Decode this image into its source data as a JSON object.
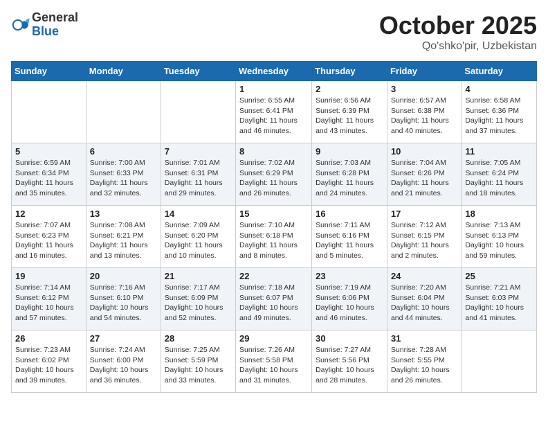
{
  "logo": {
    "general": "General",
    "blue": "Blue"
  },
  "header": {
    "month": "October 2025",
    "location": "Qo'shko'pir, Uzbekistan"
  },
  "weekdays": [
    "Sunday",
    "Monday",
    "Tuesday",
    "Wednesday",
    "Thursday",
    "Friday",
    "Saturday"
  ],
  "weeks": [
    [
      {
        "day": "",
        "info": ""
      },
      {
        "day": "",
        "info": ""
      },
      {
        "day": "",
        "info": ""
      },
      {
        "day": "1",
        "info": "Sunrise: 6:55 AM\nSunset: 6:41 PM\nDaylight: 11 hours and 46 minutes."
      },
      {
        "day": "2",
        "info": "Sunrise: 6:56 AM\nSunset: 6:39 PM\nDaylight: 11 hours and 43 minutes."
      },
      {
        "day": "3",
        "info": "Sunrise: 6:57 AM\nSunset: 6:38 PM\nDaylight: 11 hours and 40 minutes."
      },
      {
        "day": "4",
        "info": "Sunrise: 6:58 AM\nSunset: 6:36 PM\nDaylight: 11 hours and 37 minutes."
      }
    ],
    [
      {
        "day": "5",
        "info": "Sunrise: 6:59 AM\nSunset: 6:34 PM\nDaylight: 11 hours and 35 minutes."
      },
      {
        "day": "6",
        "info": "Sunrise: 7:00 AM\nSunset: 6:33 PM\nDaylight: 11 hours and 32 minutes."
      },
      {
        "day": "7",
        "info": "Sunrise: 7:01 AM\nSunset: 6:31 PM\nDaylight: 11 hours and 29 minutes."
      },
      {
        "day": "8",
        "info": "Sunrise: 7:02 AM\nSunset: 6:29 PM\nDaylight: 11 hours and 26 minutes."
      },
      {
        "day": "9",
        "info": "Sunrise: 7:03 AM\nSunset: 6:28 PM\nDaylight: 11 hours and 24 minutes."
      },
      {
        "day": "10",
        "info": "Sunrise: 7:04 AM\nSunset: 6:26 PM\nDaylight: 11 hours and 21 minutes."
      },
      {
        "day": "11",
        "info": "Sunrise: 7:05 AM\nSunset: 6:24 PM\nDaylight: 11 hours and 18 minutes."
      }
    ],
    [
      {
        "day": "12",
        "info": "Sunrise: 7:07 AM\nSunset: 6:23 PM\nDaylight: 11 hours and 16 minutes."
      },
      {
        "day": "13",
        "info": "Sunrise: 7:08 AM\nSunset: 6:21 PM\nDaylight: 11 hours and 13 minutes."
      },
      {
        "day": "14",
        "info": "Sunrise: 7:09 AM\nSunset: 6:20 PM\nDaylight: 11 hours and 10 minutes."
      },
      {
        "day": "15",
        "info": "Sunrise: 7:10 AM\nSunset: 6:18 PM\nDaylight: 11 hours and 8 minutes."
      },
      {
        "day": "16",
        "info": "Sunrise: 7:11 AM\nSunset: 6:16 PM\nDaylight: 11 hours and 5 minutes."
      },
      {
        "day": "17",
        "info": "Sunrise: 7:12 AM\nSunset: 6:15 PM\nDaylight: 11 hours and 2 minutes."
      },
      {
        "day": "18",
        "info": "Sunrise: 7:13 AM\nSunset: 6:13 PM\nDaylight: 10 hours and 59 minutes."
      }
    ],
    [
      {
        "day": "19",
        "info": "Sunrise: 7:14 AM\nSunset: 6:12 PM\nDaylight: 10 hours and 57 minutes."
      },
      {
        "day": "20",
        "info": "Sunrise: 7:16 AM\nSunset: 6:10 PM\nDaylight: 10 hours and 54 minutes."
      },
      {
        "day": "21",
        "info": "Sunrise: 7:17 AM\nSunset: 6:09 PM\nDaylight: 10 hours and 52 minutes."
      },
      {
        "day": "22",
        "info": "Sunrise: 7:18 AM\nSunset: 6:07 PM\nDaylight: 10 hours and 49 minutes."
      },
      {
        "day": "23",
        "info": "Sunrise: 7:19 AM\nSunset: 6:06 PM\nDaylight: 10 hours and 46 minutes."
      },
      {
        "day": "24",
        "info": "Sunrise: 7:20 AM\nSunset: 6:04 PM\nDaylight: 10 hours and 44 minutes."
      },
      {
        "day": "25",
        "info": "Sunrise: 7:21 AM\nSunset: 6:03 PM\nDaylight: 10 hours and 41 minutes."
      }
    ],
    [
      {
        "day": "26",
        "info": "Sunrise: 7:23 AM\nSunset: 6:02 PM\nDaylight: 10 hours and 39 minutes."
      },
      {
        "day": "27",
        "info": "Sunrise: 7:24 AM\nSunset: 6:00 PM\nDaylight: 10 hours and 36 minutes."
      },
      {
        "day": "28",
        "info": "Sunrise: 7:25 AM\nSunset: 5:59 PM\nDaylight: 10 hours and 33 minutes."
      },
      {
        "day": "29",
        "info": "Sunrise: 7:26 AM\nSunset: 5:58 PM\nDaylight: 10 hours and 31 minutes."
      },
      {
        "day": "30",
        "info": "Sunrise: 7:27 AM\nSunset: 5:56 PM\nDaylight: 10 hours and 28 minutes."
      },
      {
        "day": "31",
        "info": "Sunrise: 7:28 AM\nSunset: 5:55 PM\nDaylight: 10 hours and 26 minutes."
      },
      {
        "day": "",
        "info": ""
      }
    ]
  ]
}
